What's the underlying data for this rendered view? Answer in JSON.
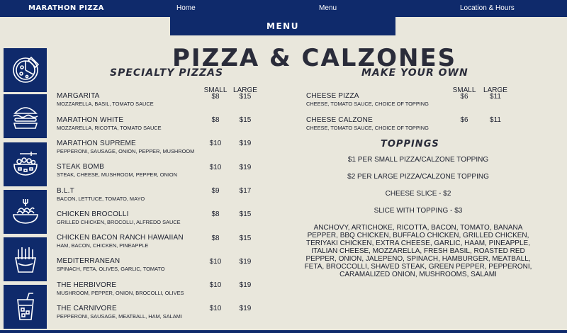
{
  "nav": {
    "brand": "MARATHON PIZZA",
    "home": "Home",
    "menu": "Menu",
    "location": "Location & Hours"
  },
  "page_tab": "MENU",
  "title": "PIZZA & CALZONES",
  "specialty": {
    "heading": "SPECIALTY PIZZAS",
    "col_small": "SMALL",
    "col_large": "LARGE",
    "items": [
      {
        "name": "MARGARITA",
        "desc": "MOZZARELLA, BASIL, TOMATO SAUCE",
        "small": "$8",
        "large": "$15"
      },
      {
        "name": "MARATHON WHITE",
        "desc": "MOZZARELLA, RICOTTA, TOMATO SAUCE",
        "small": "$8",
        "large": "$15"
      },
      {
        "name": "MARATHON SUPREME",
        "desc": "PEPPERONI, SAUSAGE, ONION, PEPPER, MUSHROOM",
        "small": "$10",
        "large": "$19"
      },
      {
        "name": "STEAK BOMB",
        "desc": "STEAK, CHEESE, MUSHROOM, PEPPER, ONION",
        "small": "$10",
        "large": "$19"
      },
      {
        "name": "B.L.T",
        "desc": "BACON, LETTUCE, TOMATO, MAYO",
        "small": "$9",
        "large": "$17"
      },
      {
        "name": "CHICKEN BROCOLLI",
        "desc": "GRILLED CHICKEN, BROCOLLI, ALFREDO SAUCE",
        "small": "$8",
        "large": "$15"
      },
      {
        "name": "CHICKEN BACON RANCH HAWAIIAN",
        "desc": "HAM, BACON, CHICKEN, PINEAPPLE",
        "small": "$8",
        "large": "$15"
      },
      {
        "name": "MEDITERRANEAN",
        "desc": "SPINACH, FETA, OLIVES, GARLIC, TOMATO",
        "small": "$10",
        "large": "$19"
      },
      {
        "name": "THE HERBIVORE",
        "desc": "MUSHROOM, PEPPER, ONION, BROCOLLI, OLIVES",
        "small": "$10",
        "large": "$19"
      },
      {
        "name": "THE CARNIVORE",
        "desc": "PEPPERONI, SAUSAGE, MEATBALL, HAM, SALAMI",
        "small": "$10",
        "large": "$19"
      }
    ]
  },
  "own": {
    "heading": "MAKE YOUR OWN",
    "col_small": "SMALL",
    "col_large": "LARGE",
    "items": [
      {
        "name": "CHEESE PIZZA",
        "desc": "CHEESE, TOMATO SAUCE, CHOICE OF TOPPING",
        "small": "$6",
        "large": "$11"
      },
      {
        "name": "CHEESE CALZONE",
        "desc": "CHEESE, TOMATO SAUCE, CHOICE OF TOPPING",
        "small": "$6",
        "large": "$11"
      }
    ]
  },
  "toppings": {
    "heading": "TOPPINGS",
    "lines": [
      "$1 PER SMALL PIZZA/CALZONE TOPPING",
      "$2 PER LARGE PIZZA/CALZONE TOPPING",
      "CHEESE SLICE - $2",
      "SLICE WITH TOPPING - $3"
    ],
    "list": "ANCHOVY, ARTICHOKE, RICOTTA, BACON, TOMATO, BANANA PEPPER, BBQ CHICKEN, BUFFALO CHICKEN, GRILLED CHICKEN, TERIYAKI CHICKEN, EXTRA CHEESE, GARLIC, HAAM, PINEAPPLE, ITALIAN CHEESE, MOZZARELLA, FRESH BASIL, ROASTED RED PEPPER, ONION, JALEPENO, SPINACH, HAMBURGER, MEATBALL, FETA, BROCCOLLI, SHAVED STEAK, GREEN PEPPER, PEPPERONI, CARAMALIZED ONION, MUSHROOMS, SALAMI"
  },
  "sidebar_icons": [
    "pizza-icon",
    "burger-icon",
    "salad-icon",
    "pasta-icon",
    "fries-icon",
    "drink-icon"
  ],
  "colors": {
    "navy": "#0f2a6b",
    "background": "#e9e7dc",
    "text": "#1b1f2e"
  }
}
